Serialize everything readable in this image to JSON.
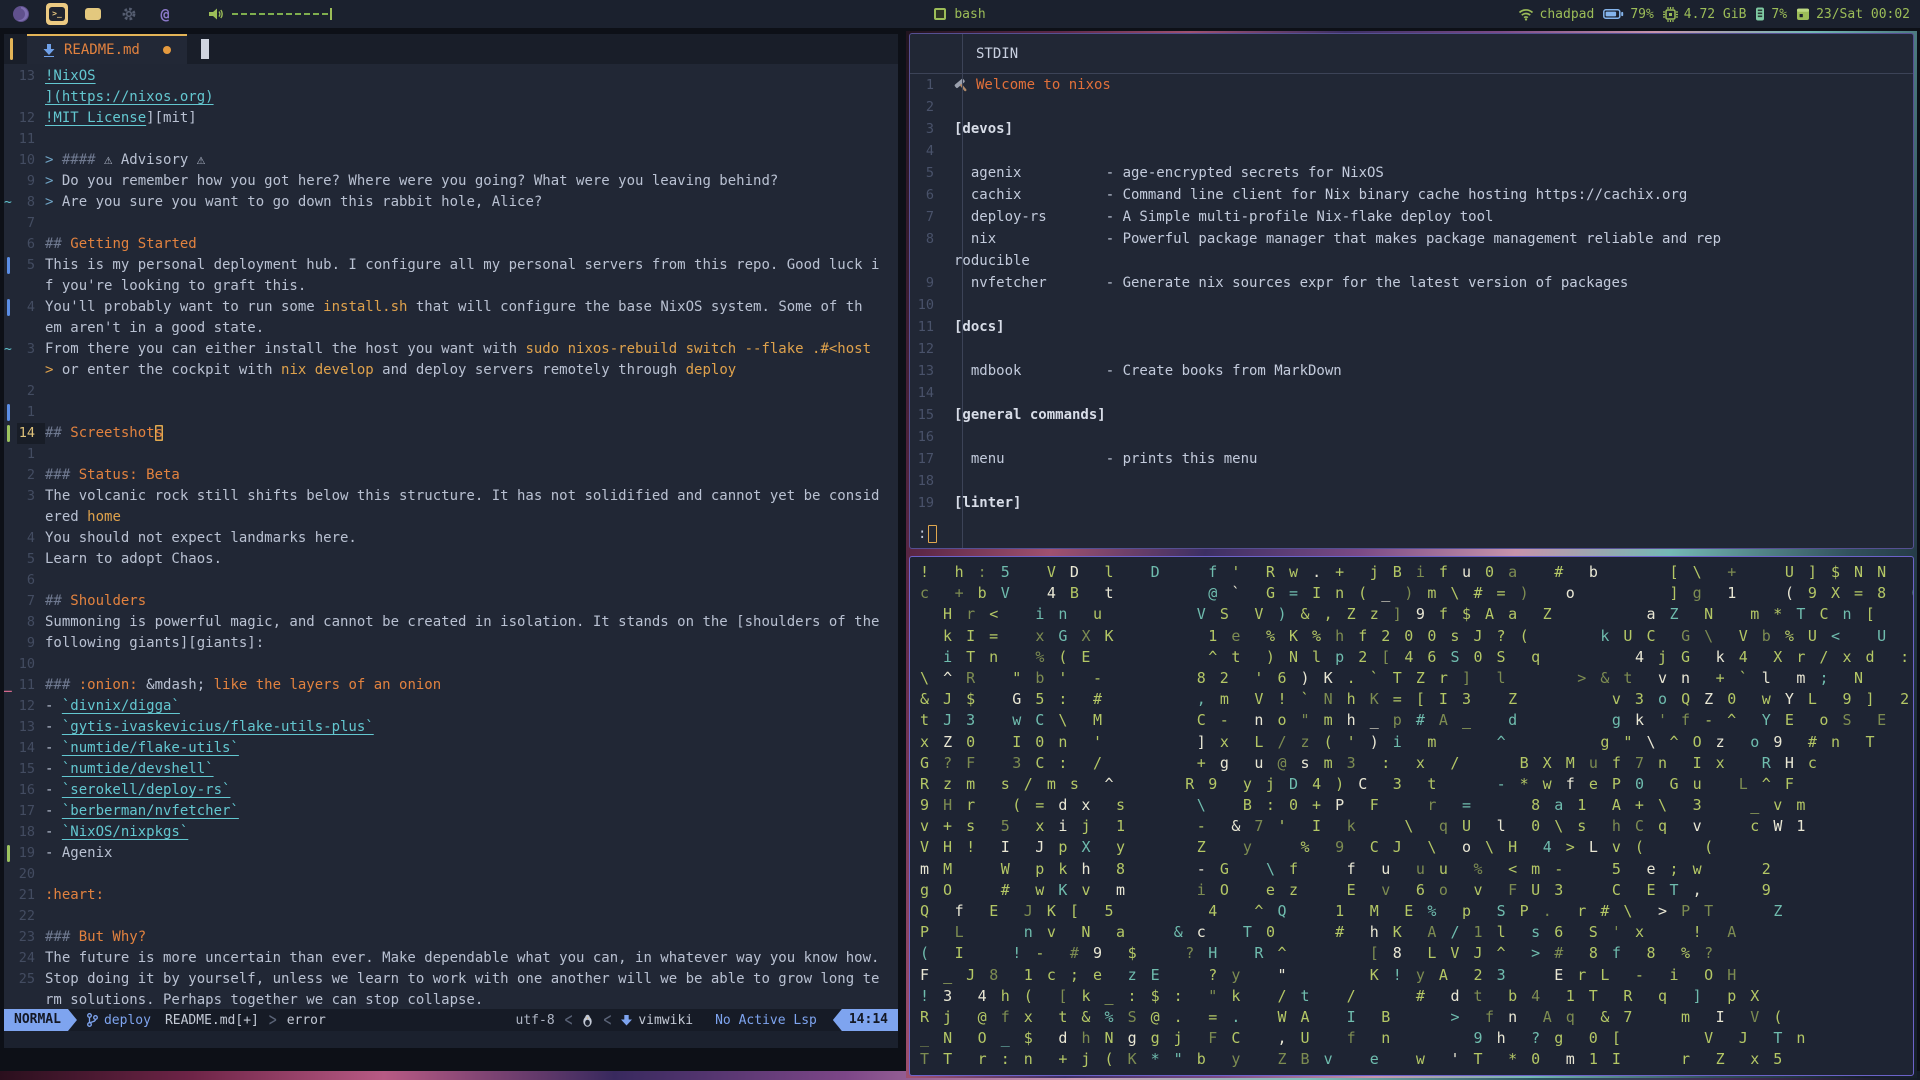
{
  "topbar": {
    "window_title": "bash",
    "workspace_icons": [
      "firefox-icon",
      "terminal-icon",
      "message-icon",
      "gear-icon",
      "at-icon"
    ],
    "volume_icon": "speaker-icon",
    "hostname": "chadpad",
    "battery": "79%",
    "memory": "4.72 GiB",
    "cpu": "7%",
    "clock": "23/Sat 00:02",
    "accent_green": "#9cbd58",
    "accent_blue": "#85b5ec"
  },
  "editor": {
    "tab": {
      "filename": "README.md",
      "modified_dot": "dot"
    },
    "lines": [
      {
        "n": "13",
        "segs": [
          [
            "ln",
            "!NixOS"
          ]
        ]
      },
      {
        "n": "",
        "segs": [
          [
            "ln",
            "](https://nixos.org)"
          ]
        ]
      },
      {
        "n": "12",
        "segs": [
          [
            "ln",
            "!MIT License"
          ],
          [
            "tx",
            "][mit]"
          ]
        ]
      },
      {
        "n": "11",
        "segs": []
      },
      {
        "n": "10",
        "segs": [
          [
            "qt",
            "> "
          ],
          [
            "hd",
            "#### "
          ],
          [
            "tx",
            "⚠ Advisory ⚠"
          ]
        ]
      },
      {
        "n": "9",
        "segs": [
          [
            "qt",
            "> "
          ],
          [
            "tx",
            "Do you remember how you got here? Where were you going? What were you leaving behind?"
          ]
        ]
      },
      {
        "n": "8",
        "sign": "tilde",
        "segs": [
          [
            "qt",
            "> "
          ],
          [
            "tx",
            "Are you sure you want to go down this rabbit hole, Alice?"
          ]
        ]
      },
      {
        "n": "7",
        "segs": []
      },
      {
        "n": "6",
        "segs": [
          [
            "hd",
            "## "
          ],
          [
            "or",
            "Getting Started"
          ]
        ]
      },
      {
        "n": "5",
        "sign": "bar-blue",
        "segs": [
          [
            "tx",
            "This is my personal deployment hub. I configure all my personal servers from this repo. Good luck i"
          ]
        ]
      },
      {
        "n": "",
        "segs": [
          [
            "tx",
            "f you're looking to graft this."
          ]
        ]
      },
      {
        "n": "4",
        "sign": "bar-blue",
        "segs": [
          [
            "tx",
            "You'll probably want to run some "
          ],
          [
            "cd",
            "install.sh"
          ],
          [
            "tx",
            " that will configure the base NixOS system. Some of th"
          ]
        ]
      },
      {
        "n": "",
        "segs": [
          [
            "tx",
            "em aren't in a good state."
          ]
        ]
      },
      {
        "n": "3",
        "sign": "tilde",
        "segs": [
          [
            "tx",
            "From there you can either install the host you want with "
          ],
          [
            "cd",
            "sudo nixos-rebuild switch --flake .#<host"
          ]
        ]
      },
      {
        "n": "",
        "segs": [
          [
            "cd",
            "> "
          ],
          [
            "tx",
            "or enter the cockpit with "
          ],
          [
            "cd",
            "nix develop"
          ],
          [
            "tx",
            " and deploy servers remotely through "
          ],
          [
            "cd",
            "deploy"
          ]
        ]
      },
      {
        "n": "2",
        "segs": []
      },
      {
        "n": "1",
        "sign": "bar-blue",
        "segs": []
      },
      {
        "n": "14",
        "cur": true,
        "sign": "bar-green",
        "segs": [
          [
            "hd",
            "## "
          ],
          [
            "or",
            "Screetshot"
          ],
          [
            "orc",
            "s"
          ]
        ]
      },
      {
        "n": "1",
        "segs": []
      },
      {
        "n": "2",
        "segs": [
          [
            "hd",
            "### "
          ],
          [
            "or",
            "Status: Beta"
          ]
        ]
      },
      {
        "n": "3",
        "segs": [
          [
            "tx",
            "The volcanic rock still shifts below this structure. It has not solidified and cannot yet be consid"
          ]
        ]
      },
      {
        "n": "",
        "segs": [
          [
            "tx",
            "ered "
          ],
          [
            "cd",
            "home"
          ]
        ]
      },
      {
        "n": "4",
        "segs": [
          [
            "tx",
            "You should not expect landmarks here."
          ]
        ]
      },
      {
        "n": "5",
        "segs": [
          [
            "tx",
            "Learn to adopt Chaos."
          ]
        ]
      },
      {
        "n": "6",
        "segs": []
      },
      {
        "n": "7",
        "segs": [
          [
            "hd",
            "## "
          ],
          [
            "or",
            "Shoulders"
          ]
        ]
      },
      {
        "n": "8",
        "segs": [
          [
            "tx",
            "Summoning is powerful magic, and cannot be created in isolation. It stands on the [shoulders of the"
          ]
        ]
      },
      {
        "n": "9",
        "segs": [
          [
            "tx",
            "following giants][giants]:"
          ]
        ]
      },
      {
        "n": "10",
        "segs": []
      },
      {
        "n": "11",
        "sign": "del",
        "segs": [
          [
            "hd",
            "### "
          ],
          [
            "or",
            ":onion: "
          ],
          [
            "tx",
            "&mdash; "
          ],
          [
            "or",
            "like the layers of an onion"
          ]
        ]
      },
      {
        "n": "12",
        "segs": [
          [
            "tx",
            "- "
          ],
          [
            "ln",
            "`divnix/digga`"
          ]
        ]
      },
      {
        "n": "13",
        "segs": [
          [
            "tx",
            "- "
          ],
          [
            "ln",
            "`gytis-ivaskevicius/flake-utils-plus`"
          ]
        ]
      },
      {
        "n": "14",
        "segs": [
          [
            "tx",
            "- "
          ],
          [
            "ln",
            "`numtide/flake-utils`"
          ]
        ]
      },
      {
        "n": "15",
        "segs": [
          [
            "tx",
            "- "
          ],
          [
            "ln",
            "`numtide/devshell`"
          ]
        ]
      },
      {
        "n": "16",
        "segs": [
          [
            "tx",
            "- "
          ],
          [
            "ln",
            "`serokell/deploy-rs`"
          ]
        ]
      },
      {
        "n": "17",
        "segs": [
          [
            "tx",
            "- "
          ],
          [
            "ln",
            "`berberman/nvfetcher`"
          ]
        ]
      },
      {
        "n": "18",
        "segs": [
          [
            "tx",
            "- "
          ],
          [
            "ln",
            "`NixOS/nixpkgs`"
          ]
        ]
      },
      {
        "n": "19",
        "sign": "bar-green",
        "segs": [
          [
            "tx",
            "- Agenix"
          ]
        ]
      },
      {
        "n": "20",
        "segs": []
      },
      {
        "n": "21",
        "segs": [
          [
            "or",
            ":heart:"
          ]
        ]
      },
      {
        "n": "22",
        "segs": []
      },
      {
        "n": "23",
        "segs": [
          [
            "hd",
            "### "
          ],
          [
            "or",
            "But Why?"
          ]
        ]
      },
      {
        "n": "24",
        "segs": [
          [
            "tx",
            "The future is more uncertain than ever. Make dependable what you can, in whatever way you know how."
          ]
        ]
      },
      {
        "n": "25",
        "segs": [
          [
            "tx",
            "Stop doing it by yourself, unless we learn to work with one another will we be able to grow long te"
          ]
        ]
      },
      {
        "n": "",
        "segs": [
          [
            "tx",
            "rm solutions. Perhaps together we can stop collapse."
          ]
        ]
      }
    ],
    "statusline": {
      "mode": "NORMAL",
      "branch": "deploy",
      "file": "README.md[+]",
      "chev_right": ">",
      "error": "error",
      "encoding": "utf-8",
      "chev_left": "<",
      "filetype": "vimwiki",
      "lsp": "No Active Lsp",
      "time": "14:14"
    }
  },
  "pager": {
    "title": "STDIN",
    "prompt": ":",
    "lines": [
      {
        "n": "1",
        "c": "or",
        "icon": "hammer-icon",
        "t": "Welcome to nixos"
      },
      {
        "n": "2",
        "t": ""
      },
      {
        "n": "3",
        "c": "sec",
        "t": "[devos]"
      },
      {
        "n": "4",
        "t": ""
      },
      {
        "n": "5",
        "t": "  agenix          - age-encrypted secrets for NixOS"
      },
      {
        "n": "6",
        "t": "  cachix          - Command line client for Nix binary cache hosting https://cachix.org"
      },
      {
        "n": "7",
        "t": "  deploy-rs       - A Simple multi-profile Nix-flake deploy tool"
      },
      {
        "n": "8",
        "t": "  nix             - Powerful package manager that makes package management reliable and rep"
      },
      {
        "n": "",
        "t": "roducible"
      },
      {
        "n": "9",
        "t": "  nvfetcher       - Generate nix sources expr for the latest version of packages"
      },
      {
        "n": "10",
        "t": ""
      },
      {
        "n": "11",
        "c": "sec",
        "t": "[docs]"
      },
      {
        "n": "12",
        "t": ""
      },
      {
        "n": "13",
        "t": "  mdbook          - Create books from MarkDown"
      },
      {
        "n": "14",
        "t": ""
      },
      {
        "n": "15",
        "c": "sec",
        "t": "[general commands]"
      },
      {
        "n": "16",
        "t": ""
      },
      {
        "n": "17",
        "t": "  menu            - prints this menu"
      },
      {
        "n": "18",
        "t": ""
      },
      {
        "n": "19",
        "c": "sec",
        "t": "[linter]"
      }
    ]
  },
  "matrix": {
    "colors": {
      "base": "#b4c765",
      "bright": "#e9e7d4",
      "cyan": "#6fbcae",
      "dim": "#7d8c51"
    },
    "rows": [
      "!  h : 5   V D  l   D    f '  R w . +  j B i f u 0 a   #  b      [ \\  +    U ] $ N N",
      "c  + b V   4 B  t        @ `  G = I n ( _ ) m \\ # = )   o        ] g  1    ( 9 X = 8  O",
      "  H r <   i n  u        V S  V ) & , Z z ] 9 f $ A a  Z        a Z  N   m * T C n [",
      "  k I =   x G X K        1 e  % K % h f 2 0 0 s J ? (      k U C  G \\  V b % U <   U",
      "  i T n   % ( E          ^ t  ) N l p 2 [ 4 6 S 0 S  q        4 j G  k 4  X r / x d  :",
      "\\ ^ R   \" b '  -        8 2  ' 6 ) K . ` T Z r ]  l      > & t  v n  + ` l  m ;  N",
      "& J $   G 5 :  #        , m  V ! ` N h K = [ I 3   Z        v 3 o Q Z 0  w Y L  9 ]  2",
      "t J 3   w C \\  M        C -  n o \" m h _ p # A _   d        g k ' f - ^  Y E  o S  E",
      "x Z 0   I 0 n  '        ] x  L / z ( ' ) i  m     ^        g \" \\ ^ O z  o 9  # n  T",
      "G ? F   3 C :  /        + g  u @ s m 3  :  x  /     B X M u f 7 n  I x   R H c",
      "R z m  s / m s  ^      R 9  y j D 4 ) C  3  t     - * w f e P 0  G u   L ^ F",
      "9 H r   ( = d x  s      \\   B : 0 + P  F    r  =     8 a 1  A + \\  3    _ v m",
      "v + s  5  x i j  1      -  & 7 '  I  k    \\  q U  l  0 \\ s  h C q  v    c W 1",
      "V H !  I  J p X  y      Z   y    %  9  C J  \\  o \\ H  4 > L v (     (",
      "m M    W  p k h  8      - G   \\ f    f  u  u u  %  < m -    5  e ; w     2",
      "g O    #  w K v  m      i O   e z    E  v  6 o  v  F U 3    C  E T ,     9",
      "Q  f  E  J K [  5        4   ^ Q    1  M  E %  p  S P .  r # \\  > P T     Z",
      "P  L     n v  N  a    & c   T 0     #  h K  A / 1 l  s 6  S ' x    !  A",
      "(  I    ! -  # 9  $    ? H   R ^       [ 8  L V J ^  > #  8 f  8  % ?",
      "F _ J 8  1 c ; e  z E    ? y   \"       K ! y A  2 3    E r L  -  i  O H",
      "! 3  4 h (  [ k _ : $ :  \" k   / t   /     #  d t  b 4  1 T  R  q  ]  p X",
      "R j  @ f x  t & % S @ .  = .   W A   I  B     >  f n  A q  & 7    m  I  V (",
      "_ N  O _ $  d h N g g j  F C   , U   f  n       9 h  ? g  0 [       V  J  T n",
      "T T  r : n  + j ( K * \" b  y   Z B v   e   w  ' T  * 0  m 1 I     r  Z  x 5"
    ]
  }
}
